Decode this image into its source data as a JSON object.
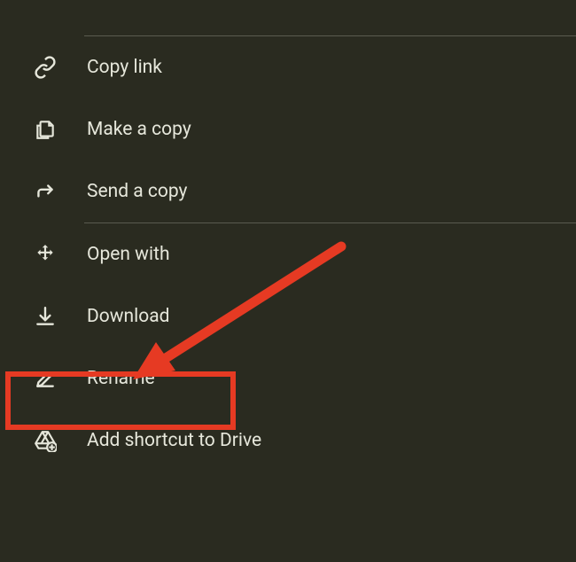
{
  "menu": {
    "items": [
      {
        "id": "copy-link",
        "label": "Copy link",
        "icon": "link-icon"
      },
      {
        "id": "make-a-copy",
        "label": "Make a copy",
        "icon": "copy-icon"
      },
      {
        "id": "send-a-copy",
        "label": "Send a copy",
        "icon": "arrow-turn-icon"
      },
      {
        "id": "open-with",
        "label": "Open with",
        "icon": "move-icon"
      },
      {
        "id": "download",
        "label": "Download",
        "icon": "download-icon",
        "highlighted": true
      },
      {
        "id": "rename",
        "label": "Rename",
        "icon": "edit-icon"
      },
      {
        "id": "add-shortcut",
        "label": "Add shortcut to Drive",
        "icon": "drive-add-icon"
      }
    ]
  },
  "annotation": {
    "highlight_color": "#e63a23"
  }
}
